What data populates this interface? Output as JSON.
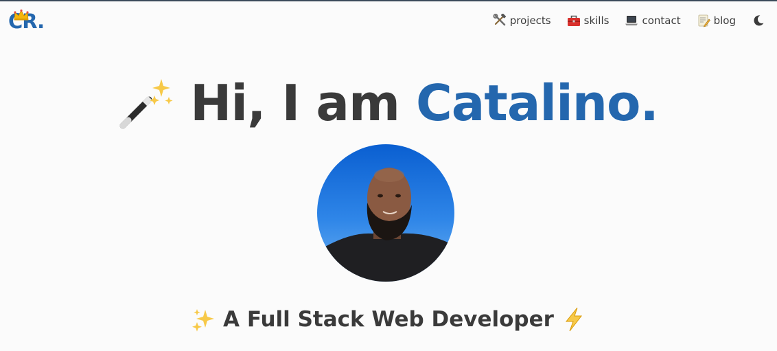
{
  "header": {
    "logo_text": "CR.",
    "logo_icon": "crown-icon",
    "nav": [
      {
        "label": "projects",
        "icon": "hammer-wrench-icon"
      },
      {
        "label": "skills",
        "icon": "toolbox-icon"
      },
      {
        "label": "contact",
        "icon": "laptop-icon"
      },
      {
        "label": "blog",
        "icon": "memo-icon"
      }
    ],
    "theme_toggle_icon": "moon-icon"
  },
  "hero": {
    "greeting": "Hi, I am",
    "name": "Catalino.",
    "leading_icon": "magic-wand-icon"
  },
  "avatar": {
    "icon": "profile-photo"
  },
  "tagline": {
    "text": "A Full Stack Web Developer",
    "leading_icon": "sparkles-icon",
    "trailing_icon": "lightning-icon"
  },
  "colors": {
    "accent": "#2467ae",
    "text": "#3a3a3a",
    "background": "#fbfbfb"
  }
}
